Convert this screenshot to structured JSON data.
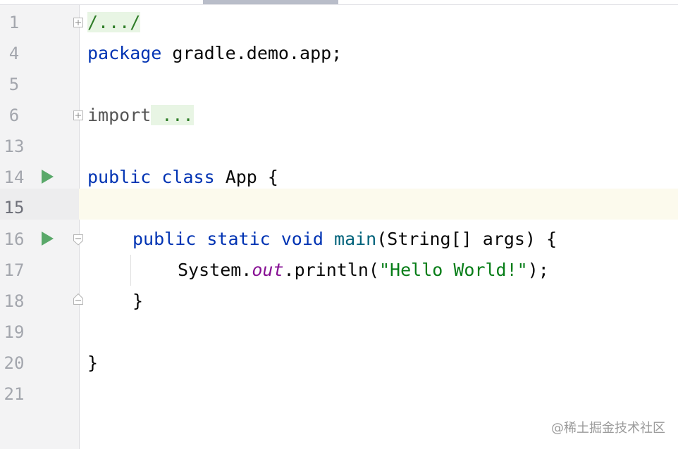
{
  "gutter": {
    "line_numbers": [
      "1",
      "4",
      "5",
      "6",
      "13",
      "14",
      "15",
      "16",
      "17",
      "18",
      "19",
      "20",
      "21"
    ],
    "current_line": "15"
  },
  "code": {
    "line_1": "/.../",
    "line_4_kw": "package",
    "line_4_rest": " gradle.demo.app;",
    "line_6_kw": "import",
    "line_6_rest": " ...",
    "line_14_kw1": "public",
    "line_14_kw2": "class",
    "line_14_rest": " App {",
    "line_16_kw1": "public",
    "line_16_kw2": "static",
    "line_16_kw3": "void",
    "line_16_fn": "main",
    "line_16_rest": "(String[] args) {",
    "line_17_obj": "System.",
    "line_17_field": "out",
    "line_17_call": ".println(",
    "line_17_str": "\"Hello World!\"",
    "line_17_end": ");",
    "line_18": "}",
    "line_20": "}"
  },
  "watermark": "@稀土掘金技术社区",
  "colors": {
    "keyword": "#0033b3",
    "method": "#00627a",
    "string": "#067d17",
    "static_field": "#871094",
    "run_icon": "#59a869",
    "current_line_bg": "#fcfaed"
  },
  "icons": {
    "run": "play-triangle-icon",
    "fold_expand": "fold-plus-icon",
    "fold_collapse": "fold-minus-icon"
  }
}
